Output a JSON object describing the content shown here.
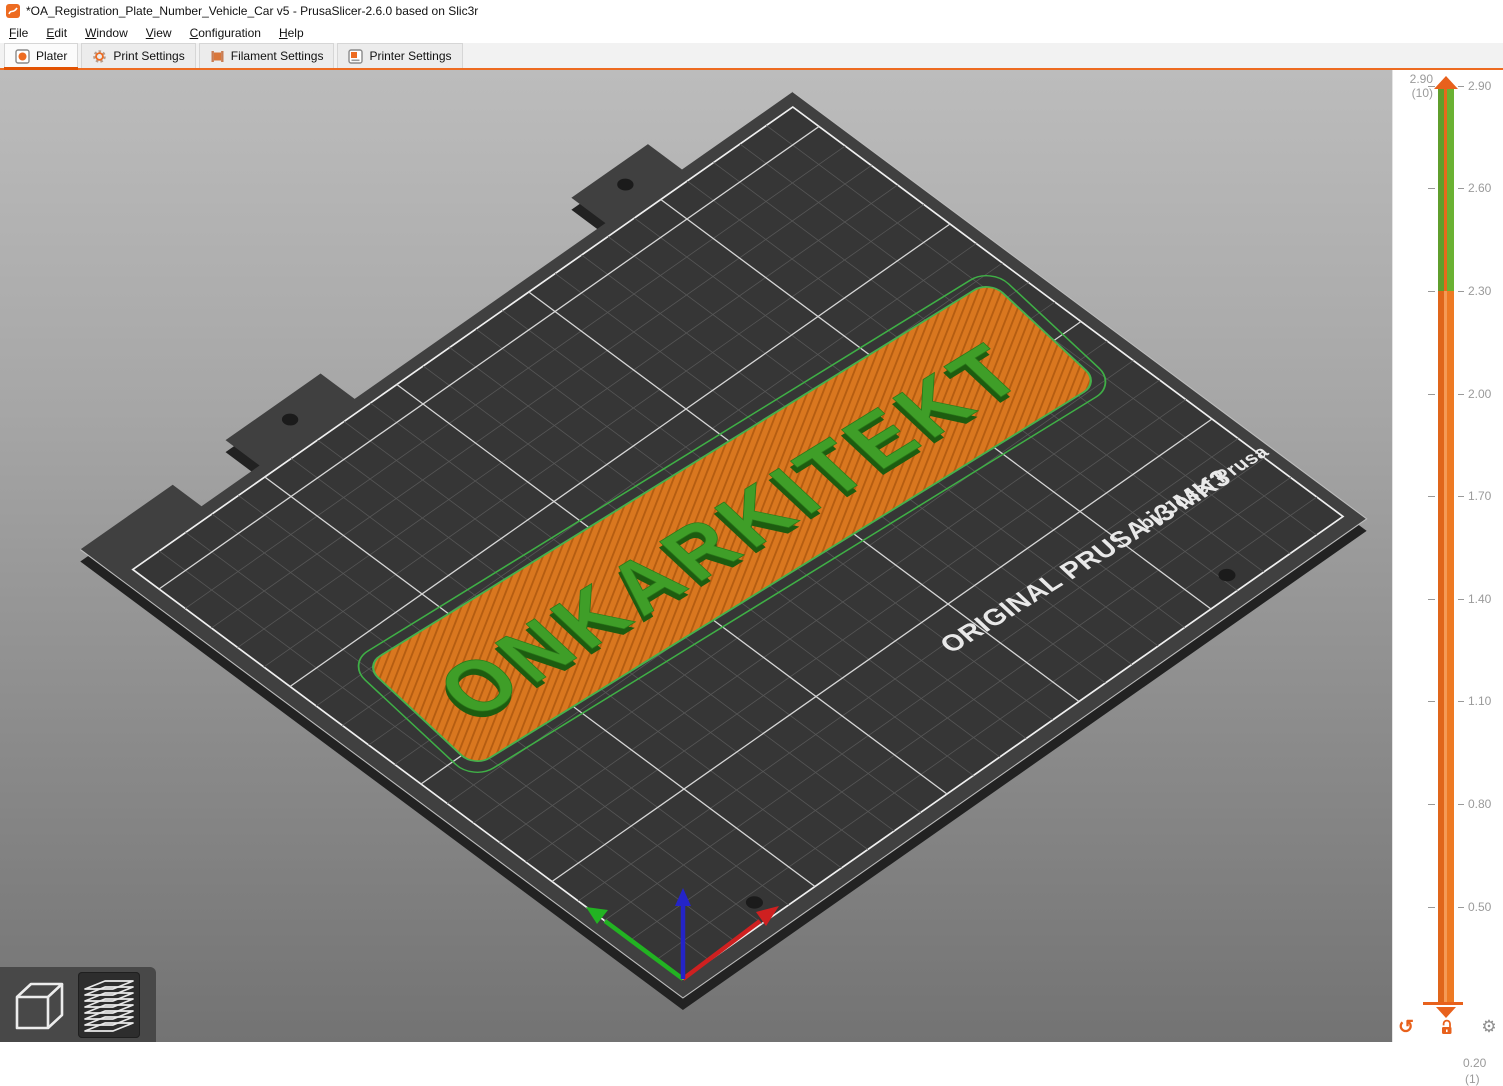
{
  "window": {
    "title": "*OA_Registration_Plate_Number_Vehicle_Car v5 - PrusaSlicer-2.6.0 based on Slic3r",
    "app_icon": "prusaslicer-logo"
  },
  "menu": {
    "items": [
      {
        "key": "F",
        "rest": "ile"
      },
      {
        "key": "E",
        "rest": "dit"
      },
      {
        "key": "W",
        "rest": "indow"
      },
      {
        "key": "V",
        "rest": "iew"
      },
      {
        "key": "C",
        "rest": "onfiguration"
      },
      {
        "key": "H",
        "rest": "elp"
      }
    ]
  },
  "tabs": {
    "selected": "Plater",
    "items": [
      {
        "label": "Plater",
        "icon": "plater-icon"
      },
      {
        "label": "Print Settings",
        "icon": "print-settings-gear-icon"
      },
      {
        "label": "Filament Settings",
        "icon": "filament-spool-icon"
      },
      {
        "label": "Printer Settings",
        "icon": "printer-icon"
      }
    ]
  },
  "viewport": {
    "bed": {
      "brand_line1": "ORIGINAL PRUSA i3 MK3",
      "brand_line2": "by Josef Prusa"
    },
    "model": {
      "text": "ONKARKITEKT",
      "body_color": "#d9771f",
      "text_color": "#3f9e28",
      "outline_color": "#46b14c"
    },
    "axes": {
      "x_color": "#cf2020",
      "y_color": "#22b322",
      "z_color": "#2424c8"
    }
  },
  "view_toolbar": {
    "modes": [
      {
        "name": "3d-editor-view",
        "icon": "cube-icon",
        "active": false
      },
      {
        "name": "preview-sliced-layers",
        "icon": "layers-icon",
        "active": true
      }
    ]
  },
  "layer_slider": {
    "top_value": "2.90",
    "top_layer": "(10)",
    "bottom_value": "0.20",
    "bottom_layer": "(1)",
    "ticks": [
      "2.90",
      "2.60",
      "2.30",
      "2.00",
      "1.70",
      "1.40",
      "1.10",
      "0.80",
      "0.50"
    ],
    "green_color": "#66ad30",
    "orange_color": "#ee7a23"
  },
  "colors": {
    "accent_orange": "#ed6b21",
    "bed_sheet": "#404040",
    "print_area": "#363636",
    "grid_minor": "#565656",
    "grid_major": "#d6d6d6"
  }
}
